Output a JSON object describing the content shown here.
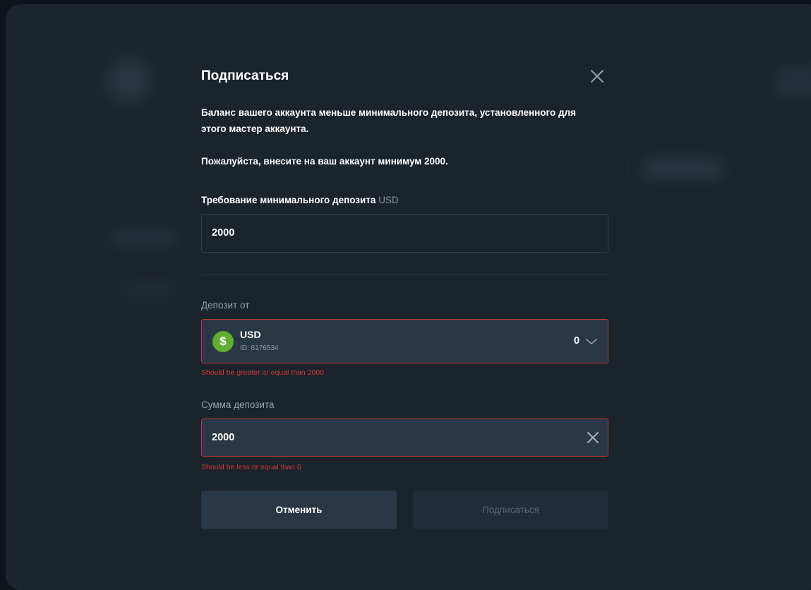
{
  "modal": {
    "title": "Подписаться",
    "message_line1": "Баланс вашего аккаунта меньше минимального депозита, установленного для",
    "message_line2": "этого мастер аккаунта.",
    "message_deposit": "Пожалуйста, внесите на ваш аккаунт минимум 2000.",
    "min_deposit": {
      "label": "Требование минимального депозита",
      "unit": "USD",
      "value": "2000"
    },
    "deposit_from": {
      "label": "Депозит от",
      "account_currency": "USD",
      "account_id": "ID: 6176534",
      "account_balance": "0",
      "currency_icon": "dollar-coin-icon",
      "error": "Should be greater or equal than 2000"
    },
    "deposit_amount": {
      "label": "Сумма депозита",
      "value": "2000",
      "error": "Should be less or equal than 0"
    },
    "buttons": {
      "cancel": "Отменить",
      "subscribe": "Подписаться"
    }
  },
  "colors": {
    "error": "#d13a3a",
    "coin": "#5fae2f",
    "modal_bg": "#1b232b",
    "field_bg": "#2a3744"
  }
}
